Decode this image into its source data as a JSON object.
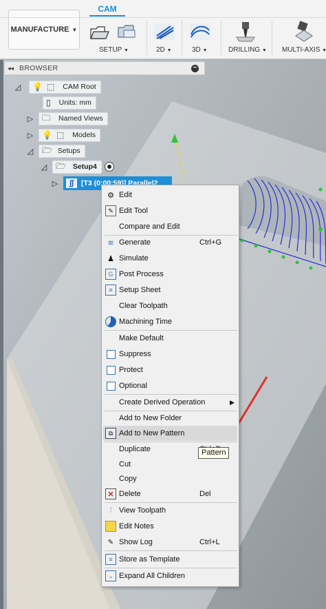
{
  "toolbar": {
    "workspace_label": "MANUFACTURE",
    "active_tab": "CAM",
    "groups": [
      {
        "label": "SETUP",
        "icon": "setup-icon"
      },
      {
        "label": "2D",
        "icon": "2d-toolpath-icon"
      },
      {
        "label": "3D",
        "icon": "3d-toolpath-icon"
      },
      {
        "label": "DRILLING",
        "icon": "drill-icon"
      },
      {
        "label": "MULTI-AXIS",
        "icon": "multi-axis-icon"
      }
    ]
  },
  "browser": {
    "title": "BROWSER",
    "tree": {
      "cam_root": "CAM Root",
      "units": "Units: mm",
      "named_views": "Named Views",
      "models": "Models",
      "setups": "Setups",
      "setup4": "Setup4",
      "operation": "[T3 (0:00:59)] Parallel2"
    }
  },
  "context_menu": {
    "items": [
      {
        "label": "Edit",
        "icon": "edit-icon",
        "shortcut": ""
      },
      {
        "label": "Edit Tool",
        "icon": "edit-tool-icon",
        "shortcut": ""
      },
      {
        "label": "Compare and Edit",
        "icon": "",
        "shortcut": ""
      },
      {
        "label": "Generate",
        "icon": "generate-icon",
        "shortcut": "Ctrl+G"
      },
      {
        "label": "Simulate",
        "icon": "simulate-icon",
        "shortcut": ""
      },
      {
        "label": "Post Process",
        "icon": "post-process-icon",
        "shortcut": ""
      },
      {
        "label": "Setup Sheet",
        "icon": "setup-sheet-icon",
        "shortcut": ""
      },
      {
        "label": "Clear Toolpath",
        "icon": "",
        "shortcut": ""
      },
      {
        "label": "Machining Time",
        "icon": "machining-time-icon",
        "shortcut": ""
      },
      {
        "label": "Make Default",
        "icon": "",
        "shortcut": ""
      },
      {
        "label": "Suppress",
        "icon": "checkbox",
        "shortcut": ""
      },
      {
        "label": "Protect",
        "icon": "checkbox",
        "shortcut": ""
      },
      {
        "label": "Optional",
        "icon": "checkbox",
        "shortcut": ""
      },
      {
        "label": "Create Derived Operation",
        "icon": "",
        "shortcut": ""
      },
      {
        "label": "Add to New Folder",
        "icon": "",
        "shortcut": ""
      },
      {
        "label": "Add to New Pattern",
        "icon": "pattern-icon",
        "shortcut": ""
      },
      {
        "label": "Duplicate",
        "icon": "",
        "shortcut": "Ctrl+D"
      },
      {
        "label": "Cut",
        "icon": "",
        "shortcut": ""
      },
      {
        "label": "Copy",
        "icon": "",
        "shortcut": ""
      },
      {
        "label": "Delete",
        "icon": "delete-icon",
        "shortcut": "Del"
      },
      {
        "label": "View Toolpath",
        "icon": "view-toolpath-icon",
        "shortcut": ""
      },
      {
        "label": "Edit Notes",
        "icon": "notes-icon",
        "shortcut": ""
      },
      {
        "label": "Show Log",
        "icon": "log-icon",
        "shortcut": "Ctrl+L"
      },
      {
        "label": "Store as Template",
        "icon": "template-icon",
        "shortcut": ""
      },
      {
        "label": "Expand All Children",
        "icon": "expand-icon",
        "shortcut": ""
      }
    ],
    "highlighted_item": "Add to New Pattern"
  },
  "tooltip": {
    "text": "Pattern"
  },
  "colors": {
    "accent": "#1a8dd8",
    "annotation_arrow": "#e0312b",
    "toolpath": "#1f2fd6",
    "selection": "#1e8fd8"
  }
}
